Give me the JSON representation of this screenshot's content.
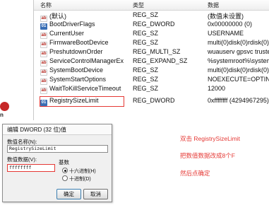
{
  "list": {
    "headers": {
      "name": "名称",
      "type": "类型",
      "data": "数据"
    },
    "rows": [
      {
        "icon": "ab",
        "name": "(默认)",
        "type": "REG_SZ",
        "data": "(数值未设置)"
      },
      {
        "icon": "bin",
        "name": "BootDriverFlags",
        "type": "REG_DWORD",
        "data": "0x00000000 (0)"
      },
      {
        "icon": "ab",
        "name": "CurrentUser",
        "type": "REG_SZ",
        "data": "USERNAME"
      },
      {
        "icon": "ab",
        "name": "FirmwareBootDevice",
        "type": "REG_SZ",
        "data": "multi(0)disk(0)rdisk(0)partition("
      },
      {
        "icon": "ab",
        "name": "PreshutdownOrder",
        "type": "REG_MULTI_SZ",
        "data": "wuauserv gpsvc trustedinstaller"
      },
      {
        "icon": "ab",
        "name": "ServiceControlManagerExte...",
        "type": "REG_EXPAND_SZ",
        "data": "%systemroot%\\system32\\scext."
      },
      {
        "icon": "ab",
        "name": "SystemBootDevice",
        "type": "REG_SZ",
        "data": "multi(0)disk(0)rdisk(0)partition("
      },
      {
        "icon": "ab",
        "name": "SystemStartOptions",
        "type": "REG_SZ",
        "data": "NOEXECUTE=OPTIN"
      },
      {
        "icon": "ab",
        "name": "WaitToKillServiceTimeout",
        "type": "REG_SZ",
        "data": "12000"
      },
      {
        "icon": "bin",
        "name": "RegistrySizeLimit",
        "type": "REG_DWORD",
        "data": "0xffffffff (4294967295)"
      }
    ]
  },
  "left_fragment": "n",
  "dialog": {
    "title": "编辑 DWORD (32 位)值",
    "value_name_label": "数值名称(N):",
    "value_name": "RegistrySizeLimit",
    "value_data_label": "数值数据(V):",
    "value_data": "ffffffff",
    "base_label": "基数",
    "radio_hex": "十六进制(H)",
    "radio_dec": "十进制(D)",
    "ok": "确定",
    "cancel": "取消"
  },
  "notes": {
    "line1": "双击 RegistrySizeLimit",
    "line2": "把数值数据改成8个F",
    "line3": "然后点确定"
  },
  "colors": {
    "annotation_red": "#e53935",
    "left_dot": "#c62828",
    "binary_icon": "#3a6fb5"
  }
}
